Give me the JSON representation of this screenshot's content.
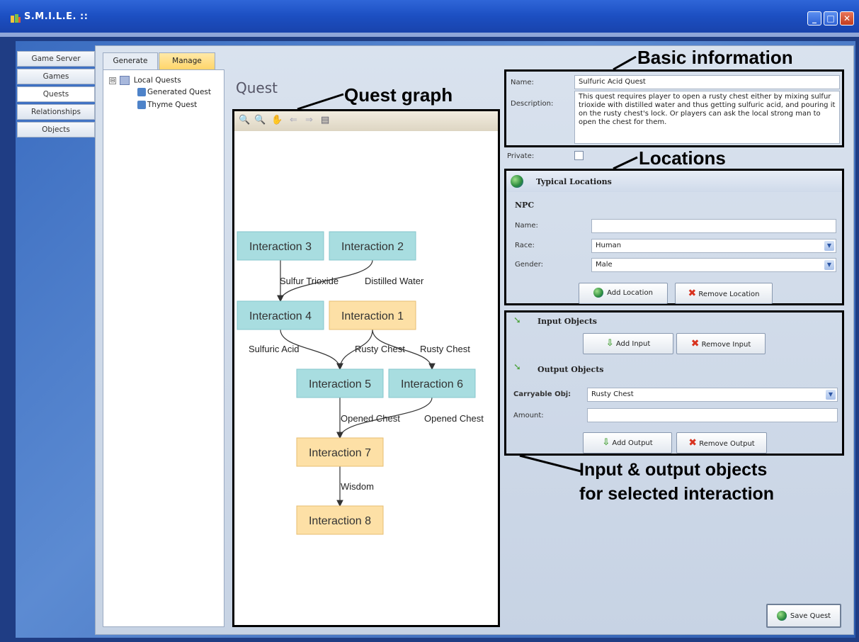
{
  "window": {
    "title": "S.M.I.L.E. ::",
    "min": "_",
    "max": "□",
    "close": "✕"
  },
  "nav": [
    {
      "label": "Game Server"
    },
    {
      "label": "Games"
    },
    {
      "label": "Quests"
    },
    {
      "label": "Relationships"
    },
    {
      "label": "Objects"
    }
  ],
  "tabs": {
    "generate": "Generate",
    "manage": "Manage"
  },
  "tree": {
    "root": "Local Quests",
    "expander": "⊟",
    "children": [
      "Generated Quest",
      "Thyme Quest"
    ]
  },
  "quest": {
    "heading": "Quest"
  },
  "toolbar": {
    "zoom_in": "🔍",
    "zoom_out": "🔍",
    "pan": "✋",
    "back": "⇐",
    "forward": "⇒",
    "print": "▤"
  },
  "graph": {
    "nodes": [
      {
        "id": "n3",
        "label": "Interaction 3",
        "kind": "blue"
      },
      {
        "id": "n2",
        "label": "Interaction 2",
        "kind": "blue"
      },
      {
        "id": "n4",
        "label": "Interaction 4",
        "kind": "blue"
      },
      {
        "id": "n1",
        "label": "Interaction 1",
        "kind": "orange"
      },
      {
        "id": "n5",
        "label": "Interaction 5",
        "kind": "blue"
      },
      {
        "id": "n6",
        "label": "Interaction 6",
        "kind": "blue"
      },
      {
        "id": "n7",
        "label": "Interaction 7",
        "kind": "orange"
      },
      {
        "id": "n8",
        "label": "Interaction 8",
        "kind": "orange"
      }
    ],
    "edges": [
      {
        "from": "n3",
        "to": "n4",
        "label": "Sulfur Trioxide"
      },
      {
        "from": "n2",
        "to": "n4",
        "label": "Distilled Water"
      },
      {
        "from": "n4",
        "to": "n5",
        "label": "Sulfuric Acid"
      },
      {
        "from": "n1",
        "to": "n5",
        "label": "Rusty Chest"
      },
      {
        "from": "n1",
        "to": "n6",
        "label": "Rusty Chest"
      },
      {
        "from": "n5",
        "to": "n7",
        "label": "Opened Chest"
      },
      {
        "from": "n6",
        "to": "n7",
        "label": "Opened Chest"
      },
      {
        "from": "n7",
        "to": "n8",
        "label": "Wisdom"
      }
    ]
  },
  "basic": {
    "name_label": "Name:",
    "name_value": "Sulfuric Acid Quest",
    "desc_label": "Description:",
    "desc_value": "This quest requires player to open a rusty chest either by mixing sulfur trioxide with distilled water and thus getting sulfuric acid, and pouring it on the rusty chest's lock. Or players can ask the local strong man to open the chest for them.",
    "private_label": "Private:"
  },
  "locations": {
    "title": "Typical Locations",
    "npc": "NPC",
    "name_label": "Name:",
    "name_value": "",
    "race_label": "Race:",
    "race_value": "Human",
    "gender_label": "Gender:",
    "gender_value": "Male",
    "add": "Add Location",
    "remove": "Remove Location"
  },
  "objects": {
    "input_title": "Input Objects",
    "add_input": "Add Input",
    "remove_input": "Remove Input",
    "output_title": "Output Objects",
    "carryable_label": "Carryable Obj:",
    "carryable_value": "Rusty Chest",
    "amount_label": "Amount:",
    "amount_value": "",
    "add_output": "Add Output",
    "remove_output": "Remove Output"
  },
  "save": "Save Quest",
  "annotations": {
    "basic": "Basic information",
    "graph": "Quest graph",
    "locations": "Locations",
    "io_line1": "Input & output objects",
    "io_line2": "for selected interaction"
  },
  "colors": {
    "node_blue": "#a8dde0",
    "node_orange": "#fde0a6",
    "titlebar": "#1c4fc2"
  }
}
